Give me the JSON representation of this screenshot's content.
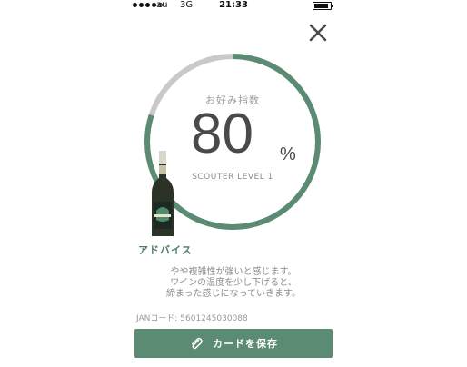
{
  "status_bar": {
    "carrier": "au",
    "network": "3G",
    "time": "21:33"
  },
  "gauge": {
    "label": "お好み指数",
    "score": "80",
    "unit": "%",
    "fraction": 0.8,
    "level": "SCOUTER LEVEL 1"
  },
  "advice": {
    "title": "アドバイス",
    "lines": [
      "やや複雑性が強いと感じます。",
      "ワインの温度を少し下げると、",
      "締まった感じになっていきます。"
    ]
  },
  "jan": "JANコード: 5601245030088",
  "save_button": {
    "label": "カードを保存",
    "icon": "paperclip-icon"
  },
  "colors": {
    "accent": "#5b8b73",
    "gauge_track": "#c9c9c9",
    "text": "#4a4a4a"
  }
}
